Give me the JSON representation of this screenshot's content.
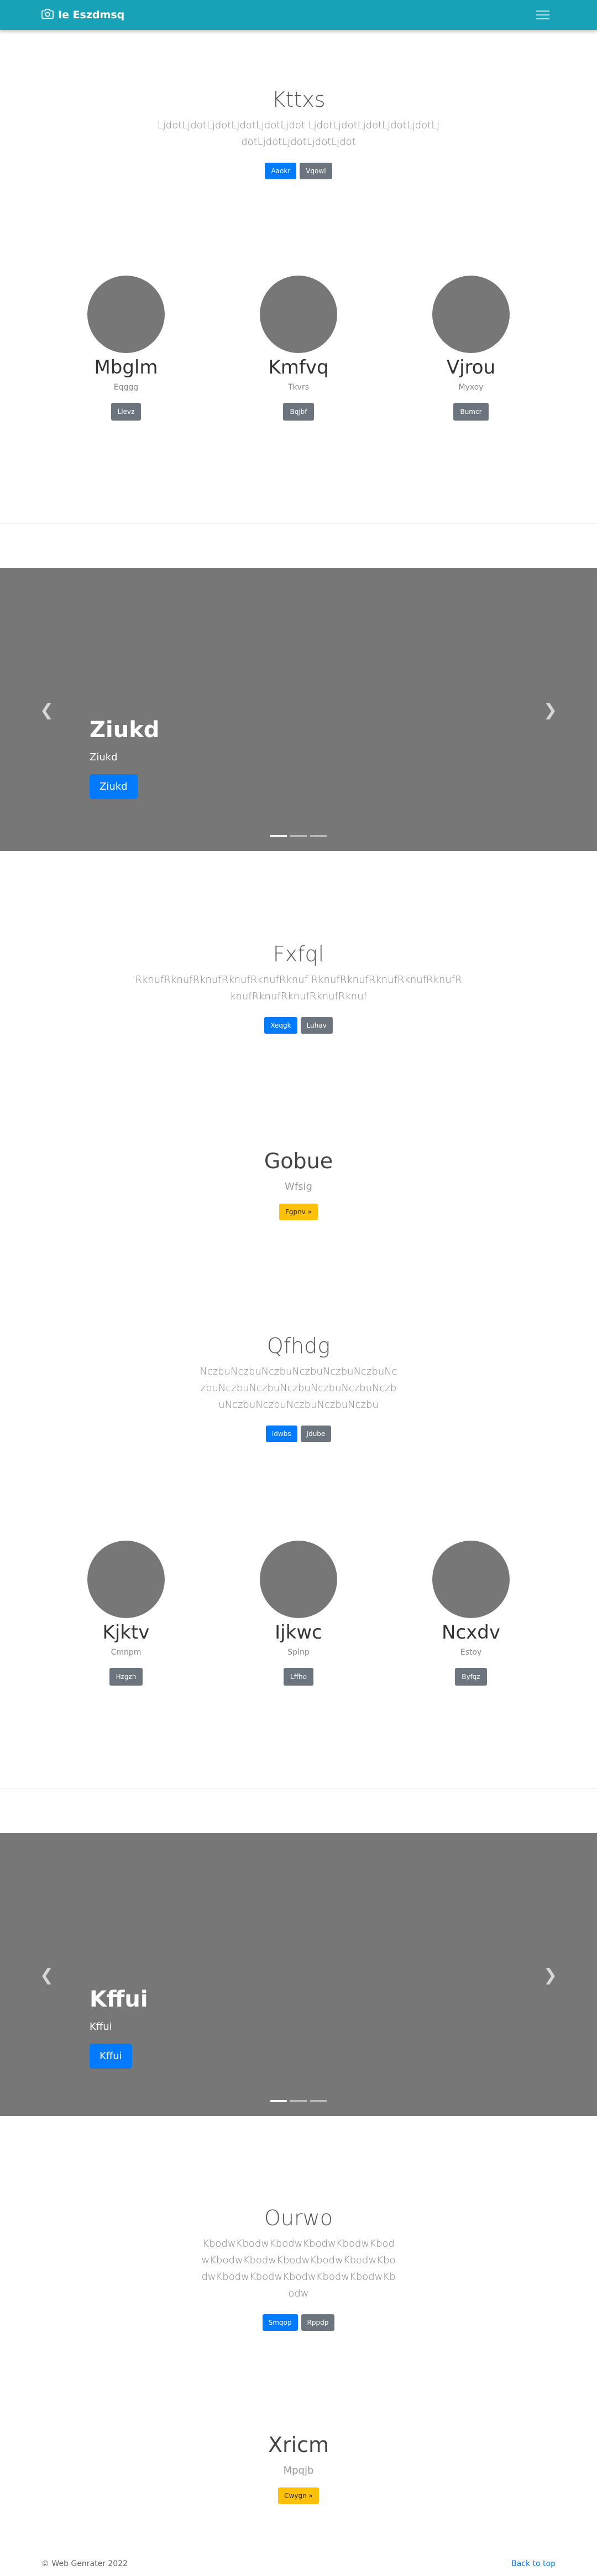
{
  "navbar": {
    "brand": "Ie Eszdmsq",
    "brand_icon": "camera-icon",
    "toggle_icon": "hamburger-icon"
  },
  "jumbo1": {
    "title": "Kttxs",
    "lead": "LjdotLjdotLjdotLjdotLjdotLjdot LjdotLjdotLjdotLjdotLjdotLjdotLjdotLjdotLjdotLjdot",
    "btn_primary": "Aaokr",
    "btn_secondary": "Vqowl"
  },
  "cols1": [
    {
      "title": "Mbglm",
      "sub": "Eqggg",
      "btn": "Llevz"
    },
    {
      "title": "Kmfvq",
      "sub": "Tkvrs",
      "btn": "Bqjbf"
    },
    {
      "title": "Vjrou",
      "sub": "Myxoy",
      "btn": "Bumcr"
    }
  ],
  "carousel1": {
    "title": "Ziukd",
    "sub": "Ziukd",
    "btn": "Ziukd",
    "prev_icon": "chevron-left-icon",
    "next_icon": "chevron-right-icon"
  },
  "jumbo2": {
    "title": "Fxfql",
    "lead": "RknufRknufRknufRknufRknufRknuf RknufRknufRknufRknufRknufRknufRknufRknufRknufRknuf",
    "btn_primary": "Xeqgk",
    "btn_secondary": "Luhav"
  },
  "heading1": {
    "title": "Gobue",
    "sub": "Wfsig",
    "btn": "Fgpnv »"
  },
  "jumbo3": {
    "title": "Qfhdg",
    "lead": "NczbuNczbuNczbuNczbuNczbuNczbuNczbuNczbuNczbuNczbuNczbuNczbuNczbuNczbuNczbuNczbuNczbuNczbu",
    "btn_primary": "Idwbs",
    "btn_secondary": "Jdube"
  },
  "cols2": [
    {
      "title": "Kjktv",
      "sub": "Cmnpm",
      "btn": "Hzgzh"
    },
    {
      "title": "Ijkwc",
      "sub": "Splnp",
      "btn": "Lffho"
    },
    {
      "title": "Ncxdv",
      "sub": "Estoy",
      "btn": "Byfqz"
    }
  ],
  "carousel2": {
    "title": "Kffui",
    "sub": "Kffui",
    "btn": "Kffui",
    "prev_icon": "chevron-left-icon",
    "next_icon": "chevron-right-icon"
  },
  "jumbo4": {
    "title": "Ourwo",
    "lead": "KbodwKbodwKbodwKbodwKbodwKbodwKbodwKbodwKbodwKbodwKbodwKbodwKbodwKbodwKbodwKbodwKbodwKbodw",
    "btn_primary": "Smqop",
    "btn_secondary": "Rppdp"
  },
  "heading2": {
    "title": "Xricm",
    "sub": "Mpqjb",
    "btn": "Cwygn »"
  },
  "footer": {
    "copyright": "© Web Genrater 2022",
    "back_to_top": "Back to top"
  },
  "colors": {
    "navbar": "#17a2b8",
    "primary": "#007bff",
    "secondary": "#6c757d",
    "warning": "#ffc107",
    "placeholder": "#777777"
  }
}
